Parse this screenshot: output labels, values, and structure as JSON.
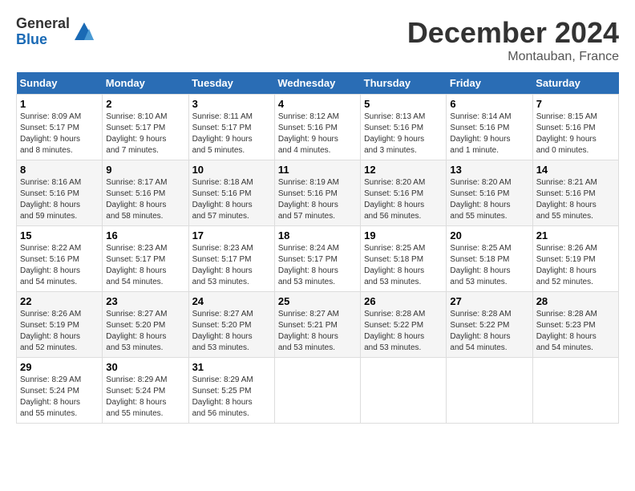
{
  "logo": {
    "general": "General",
    "blue": "Blue"
  },
  "header": {
    "month": "December 2024",
    "location": "Montauban, France"
  },
  "weekdays": [
    "Sunday",
    "Monday",
    "Tuesday",
    "Wednesday",
    "Thursday",
    "Friday",
    "Saturday"
  ],
  "weeks": [
    [
      {
        "day": "1",
        "info": "Sunrise: 8:09 AM\nSunset: 5:17 PM\nDaylight: 9 hours\nand 8 minutes."
      },
      {
        "day": "2",
        "info": "Sunrise: 8:10 AM\nSunset: 5:17 PM\nDaylight: 9 hours\nand 7 minutes."
      },
      {
        "day": "3",
        "info": "Sunrise: 8:11 AM\nSunset: 5:17 PM\nDaylight: 9 hours\nand 5 minutes."
      },
      {
        "day": "4",
        "info": "Sunrise: 8:12 AM\nSunset: 5:16 PM\nDaylight: 9 hours\nand 4 minutes."
      },
      {
        "day": "5",
        "info": "Sunrise: 8:13 AM\nSunset: 5:16 PM\nDaylight: 9 hours\nand 3 minutes."
      },
      {
        "day": "6",
        "info": "Sunrise: 8:14 AM\nSunset: 5:16 PM\nDaylight: 9 hours\nand 1 minute."
      },
      {
        "day": "7",
        "info": "Sunrise: 8:15 AM\nSunset: 5:16 PM\nDaylight: 9 hours\nand 0 minutes."
      }
    ],
    [
      {
        "day": "8",
        "info": "Sunrise: 8:16 AM\nSunset: 5:16 PM\nDaylight: 8 hours\nand 59 minutes."
      },
      {
        "day": "9",
        "info": "Sunrise: 8:17 AM\nSunset: 5:16 PM\nDaylight: 8 hours\nand 58 minutes."
      },
      {
        "day": "10",
        "info": "Sunrise: 8:18 AM\nSunset: 5:16 PM\nDaylight: 8 hours\nand 57 minutes."
      },
      {
        "day": "11",
        "info": "Sunrise: 8:19 AM\nSunset: 5:16 PM\nDaylight: 8 hours\nand 57 minutes."
      },
      {
        "day": "12",
        "info": "Sunrise: 8:20 AM\nSunset: 5:16 PM\nDaylight: 8 hours\nand 56 minutes."
      },
      {
        "day": "13",
        "info": "Sunrise: 8:20 AM\nSunset: 5:16 PM\nDaylight: 8 hours\nand 55 minutes."
      },
      {
        "day": "14",
        "info": "Sunrise: 8:21 AM\nSunset: 5:16 PM\nDaylight: 8 hours\nand 55 minutes."
      }
    ],
    [
      {
        "day": "15",
        "info": "Sunrise: 8:22 AM\nSunset: 5:16 PM\nDaylight: 8 hours\nand 54 minutes."
      },
      {
        "day": "16",
        "info": "Sunrise: 8:23 AM\nSunset: 5:17 PM\nDaylight: 8 hours\nand 54 minutes."
      },
      {
        "day": "17",
        "info": "Sunrise: 8:23 AM\nSunset: 5:17 PM\nDaylight: 8 hours\nand 53 minutes."
      },
      {
        "day": "18",
        "info": "Sunrise: 8:24 AM\nSunset: 5:17 PM\nDaylight: 8 hours\nand 53 minutes."
      },
      {
        "day": "19",
        "info": "Sunrise: 8:25 AM\nSunset: 5:18 PM\nDaylight: 8 hours\nand 53 minutes."
      },
      {
        "day": "20",
        "info": "Sunrise: 8:25 AM\nSunset: 5:18 PM\nDaylight: 8 hours\nand 53 minutes."
      },
      {
        "day": "21",
        "info": "Sunrise: 8:26 AM\nSunset: 5:19 PM\nDaylight: 8 hours\nand 52 minutes."
      }
    ],
    [
      {
        "day": "22",
        "info": "Sunrise: 8:26 AM\nSunset: 5:19 PM\nDaylight: 8 hours\nand 52 minutes."
      },
      {
        "day": "23",
        "info": "Sunrise: 8:27 AM\nSunset: 5:20 PM\nDaylight: 8 hours\nand 53 minutes."
      },
      {
        "day": "24",
        "info": "Sunrise: 8:27 AM\nSunset: 5:20 PM\nDaylight: 8 hours\nand 53 minutes."
      },
      {
        "day": "25",
        "info": "Sunrise: 8:27 AM\nSunset: 5:21 PM\nDaylight: 8 hours\nand 53 minutes."
      },
      {
        "day": "26",
        "info": "Sunrise: 8:28 AM\nSunset: 5:22 PM\nDaylight: 8 hours\nand 53 minutes."
      },
      {
        "day": "27",
        "info": "Sunrise: 8:28 AM\nSunset: 5:22 PM\nDaylight: 8 hours\nand 54 minutes."
      },
      {
        "day": "28",
        "info": "Sunrise: 8:28 AM\nSunset: 5:23 PM\nDaylight: 8 hours\nand 54 minutes."
      }
    ],
    [
      {
        "day": "29",
        "info": "Sunrise: 8:29 AM\nSunset: 5:24 PM\nDaylight: 8 hours\nand 55 minutes."
      },
      {
        "day": "30",
        "info": "Sunrise: 8:29 AM\nSunset: 5:24 PM\nDaylight: 8 hours\nand 55 minutes."
      },
      {
        "day": "31",
        "info": "Sunrise: 8:29 AM\nSunset: 5:25 PM\nDaylight: 8 hours\nand 56 minutes."
      },
      {
        "day": "",
        "info": ""
      },
      {
        "day": "",
        "info": ""
      },
      {
        "day": "",
        "info": ""
      },
      {
        "day": "",
        "info": ""
      }
    ]
  ]
}
